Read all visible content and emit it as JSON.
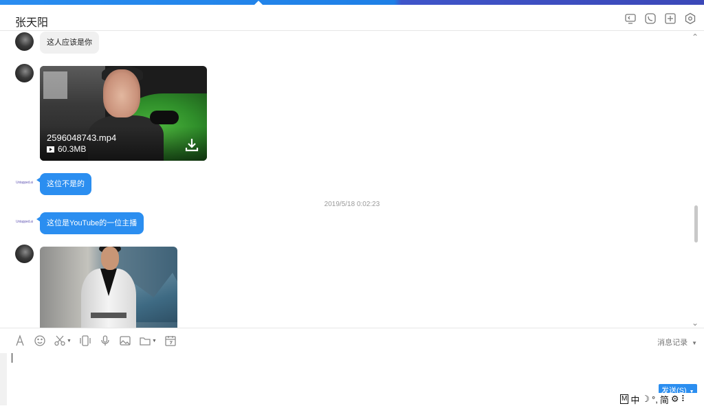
{
  "header": {
    "title": "张天阳",
    "icons": [
      "remote-desktop-icon",
      "phone-icon",
      "add-icon",
      "settings-icon"
    ]
  },
  "messages": {
    "msg1_text": "这人应该是你",
    "video": {
      "filename": "2596048743.mp4",
      "size": "60.3MB"
    },
    "msg2_text": "这位不是的",
    "timestamp": "2019/5/18 0:02:23",
    "msg3_text": "这位是YouTube的一位主播"
  },
  "toolbar": {
    "icons": [
      "font-icon",
      "emoji-icon",
      "screenshot-icon",
      "shake-icon",
      "voice-icon",
      "image-icon",
      "folder-icon",
      "calendar-icon"
    ],
    "history_label": "消息记录"
  },
  "send_label": "发送(S)",
  "ime": {
    "mode": "M",
    "lang": "中",
    "moon": "☽",
    "punct": "°,",
    "simplified": "简",
    "gear": "⚙",
    "more": "⠇"
  },
  "colors": {
    "accent": "#2b8ef0",
    "top_strip_right": "#3b48b8",
    "bubble_in": "#f0f0f0"
  }
}
